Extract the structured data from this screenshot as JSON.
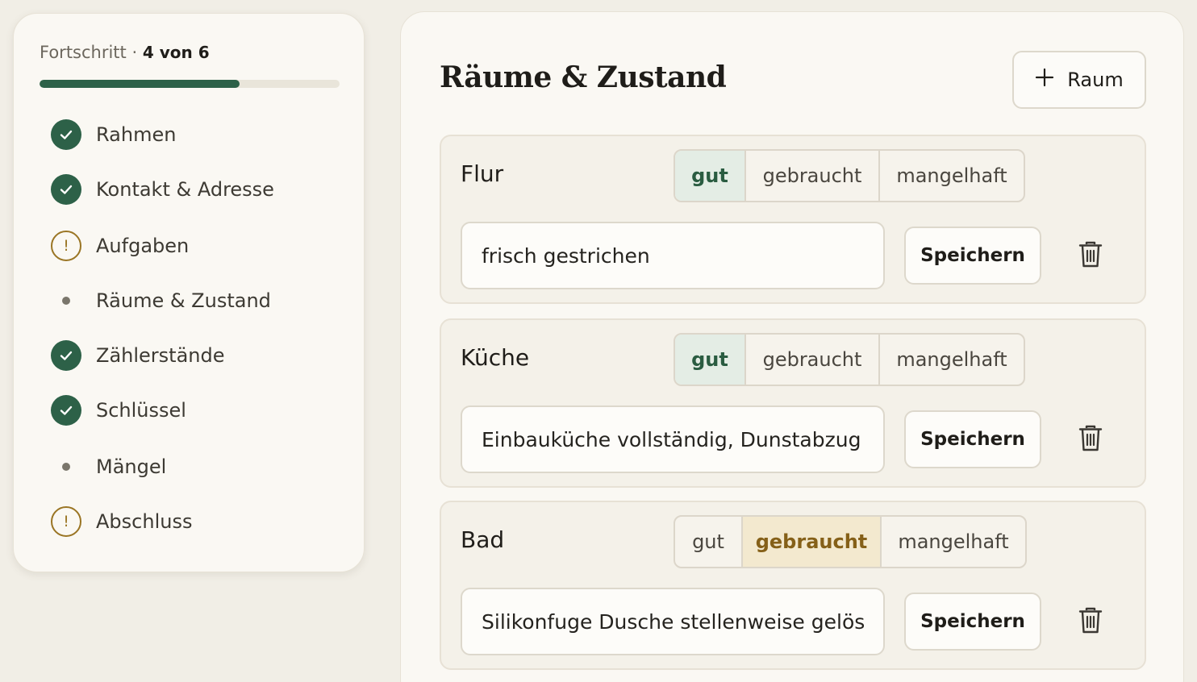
{
  "sidebar": {
    "progress_label": "Fortschritt",
    "progress_separator": "·",
    "progress_count": "4 von 6",
    "progress_fraction": 0.6667,
    "steps": [
      {
        "label": "Rahmen",
        "status": "done",
        "icon": "check-circle-icon"
      },
      {
        "label": "Kontakt & Adresse",
        "status": "done",
        "icon": "check-circle-icon"
      },
      {
        "label": "Aufgaben",
        "status": "warning",
        "icon": "warning-circle-icon"
      },
      {
        "label": "Räume & Zustand",
        "status": "current",
        "icon": "dot-icon"
      },
      {
        "label": "Zählerstände",
        "status": "done",
        "icon": "check-circle-icon"
      },
      {
        "label": "Schlüssel",
        "status": "done",
        "icon": "check-circle-icon"
      },
      {
        "label": "Mängel",
        "status": "pending",
        "icon": "dot-icon"
      },
      {
        "label": "Abschluss",
        "status": "warning",
        "icon": "warning-circle-icon"
      }
    ]
  },
  "main": {
    "title": "Räume & Zustand",
    "add_room_icon": "plus-icon",
    "add_room_label": "Raum",
    "rooms": [
      {
        "name": "Flur",
        "condition_options": [
          "gut",
          "gebraucht",
          "mangelhaft"
        ],
        "selected": "gut",
        "note": "frisch gestrichen",
        "save_label": "Speichern",
        "delete_icon": "trash-icon"
      },
      {
        "name": "Küche",
        "condition_options": [
          "gut",
          "gebraucht",
          "mangelhaft"
        ],
        "selected": "gut",
        "note": "Einbauküche vollständig, Dunstabzug g",
        "save_label": "Speichern",
        "delete_icon": "trash-icon"
      },
      {
        "name": "Bad",
        "condition_options": [
          "gut",
          "gebraucht",
          "mangelhaft"
        ],
        "selected": "gebraucht",
        "note": "Silikonfuge Dusche stellenweise gelöst",
        "save_label": "Speichern",
        "delete_icon": "trash-icon"
      }
    ]
  },
  "colors": {
    "accent_green": "#2d6148",
    "warning_amber": "#9a7524",
    "background": "#f1eee6",
    "card": "#faf8f3"
  }
}
